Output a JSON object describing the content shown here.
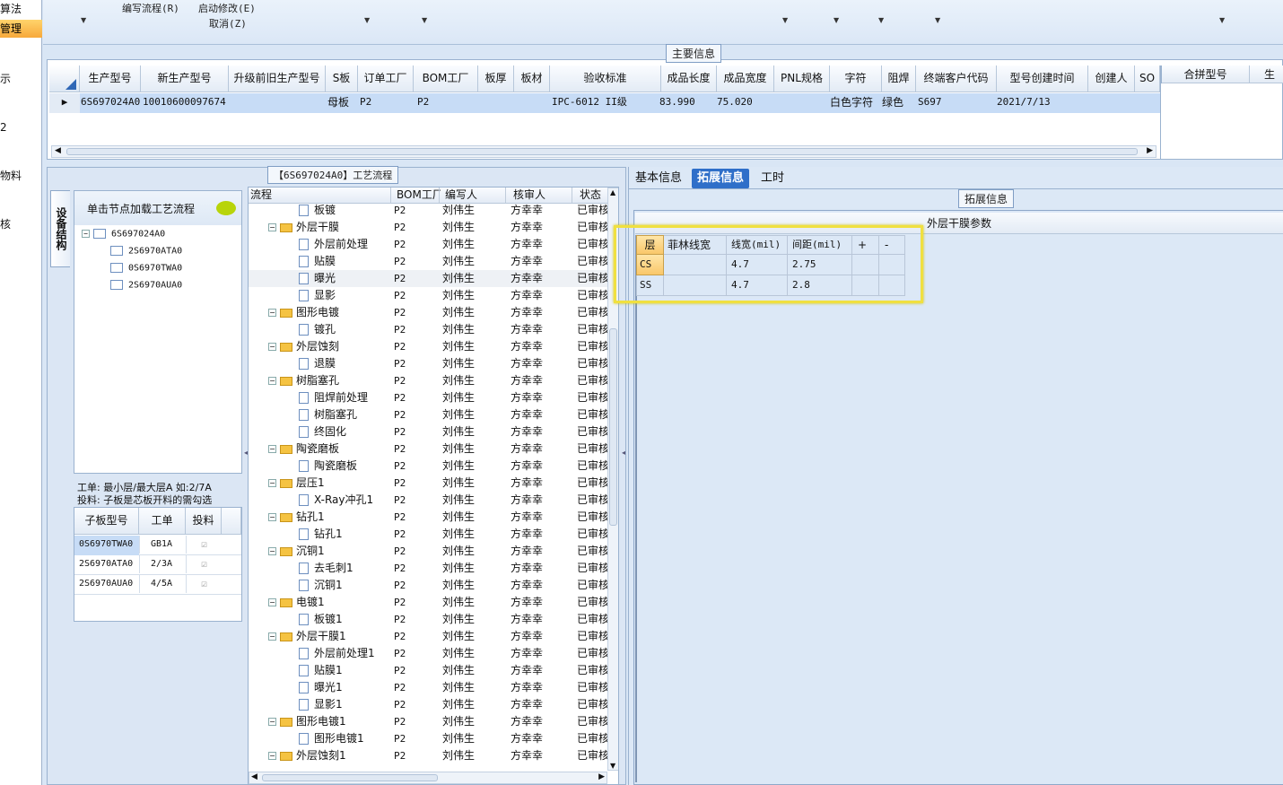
{
  "leftnav": {
    "items": [
      "算法",
      "管理",
      "示",
      "2",
      "物料",
      "核"
    ]
  },
  "toolbar": {
    "edit_flow": "编写流程(R)",
    "start_modify": "启动修改(E)",
    "cancel": "取消(Z)"
  },
  "main_info": {
    "caption": "主要信息",
    "columns": [
      "生产型号",
      "新生产型号",
      "升级前旧生产型号",
      "S板",
      "订单工厂",
      "BOM工厂",
      "板厚",
      "板材",
      "验收标准",
      "成品长度",
      "成品宽度",
      "PNL规格",
      "字符",
      "阻焊",
      "终端客户代码",
      "型号创建时间",
      "创建人",
      "SO"
    ],
    "row": [
      "6S697024A0",
      "10010600097674",
      "",
      "母板",
      "P2",
      "P2",
      "",
      "",
      "IPC-6012 II级",
      "83.990",
      "75.020",
      "",
      "白色字符",
      "绿色",
      "S697",
      "2021/7/13",
      "",
      ""
    ],
    "side_columns": [
      "合拼型号",
      "生"
    ]
  },
  "flow_panel": {
    "caption": "【6S697024A0】工艺流程"
  },
  "structure": {
    "vertical_tab": "设备结构",
    "hint": "单击节点加载工艺流程",
    "root": "6S697024A0",
    "children": [
      "2S6970ATA0",
      "0S6970TWA0",
      "2S6970AUA0"
    ],
    "note1": "工单: 最小层/最大层A 如:2/7A",
    "note2": "投料: 子板是芯板开料的需勾选",
    "sub_columns": [
      "子板型号",
      "工单",
      "投料"
    ],
    "sub_rows": [
      {
        "model": "0S6970TWA0",
        "order": "GB1A",
        "check": "☑"
      },
      {
        "model": "2S6970ATA0",
        "order": "2/3A",
        "check": "☑"
      },
      {
        "model": "2S6970AUA0",
        "order": "4/5A",
        "check": "☑"
      }
    ]
  },
  "process_tree": {
    "columns": [
      "流程",
      "BOM工厂",
      "编写人",
      "核审人",
      "状态"
    ],
    "rows": [
      {
        "name": "板镀",
        "type": "doc",
        "level": 2,
        "bom": "P2",
        "writer": "刘伟生",
        "checker": "方幸幸",
        "status": "已审核"
      },
      {
        "name": "外层干膜",
        "type": "folder",
        "level": 1,
        "bom": "P2",
        "writer": "刘伟生",
        "checker": "方幸幸",
        "status": "已审核"
      },
      {
        "name": "外层前处理",
        "type": "doc",
        "level": 2,
        "bom": "P2",
        "writer": "刘伟生",
        "checker": "方幸幸",
        "status": "已审核"
      },
      {
        "name": "贴膜",
        "type": "doc",
        "level": 2,
        "bom": "P2",
        "writer": "刘伟生",
        "checker": "方幸幸",
        "status": "已审核"
      },
      {
        "name": "曝光",
        "type": "doc",
        "level": 2,
        "bom": "P2",
        "writer": "刘伟生",
        "checker": "方幸幸",
        "status": "已审核"
      },
      {
        "name": "显影",
        "type": "doc",
        "level": 2,
        "bom": "P2",
        "writer": "刘伟生",
        "checker": "方幸幸",
        "status": "已审核"
      },
      {
        "name": "图形电镀",
        "type": "folder",
        "level": 1,
        "bom": "P2",
        "writer": "刘伟生",
        "checker": "方幸幸",
        "status": "已审核"
      },
      {
        "name": "镀孔",
        "type": "doc",
        "level": 2,
        "bom": "P2",
        "writer": "刘伟生",
        "checker": "方幸幸",
        "status": "已审核"
      },
      {
        "name": "外层蚀刻",
        "type": "folder",
        "level": 1,
        "bom": "P2",
        "writer": "刘伟生",
        "checker": "方幸幸",
        "status": "已审核"
      },
      {
        "name": "退膜",
        "type": "doc",
        "level": 2,
        "bom": "P2",
        "writer": "刘伟生",
        "checker": "方幸幸",
        "status": "已审核"
      },
      {
        "name": "树脂塞孔",
        "type": "folder",
        "level": 1,
        "bom": "P2",
        "writer": "刘伟生",
        "checker": "方幸幸",
        "status": "已审核"
      },
      {
        "name": "阻焊前处理",
        "type": "doc",
        "level": 2,
        "bom": "P2",
        "writer": "刘伟生",
        "checker": "方幸幸",
        "status": "已审核"
      },
      {
        "name": "树脂塞孔",
        "type": "doc",
        "level": 2,
        "bom": "P2",
        "writer": "刘伟生",
        "checker": "方幸幸",
        "status": "已审核"
      },
      {
        "name": "终固化",
        "type": "doc",
        "level": 2,
        "bom": "P2",
        "writer": "刘伟生",
        "checker": "方幸幸",
        "status": "已审核"
      },
      {
        "name": "陶瓷磨板",
        "type": "folder",
        "level": 1,
        "bom": "P2",
        "writer": "刘伟生",
        "checker": "方幸幸",
        "status": "已审核"
      },
      {
        "name": "陶瓷磨板",
        "type": "doc",
        "level": 2,
        "bom": "P2",
        "writer": "刘伟生",
        "checker": "方幸幸",
        "status": "已审核"
      },
      {
        "name": "层压1",
        "type": "folder",
        "level": 1,
        "bom": "P2",
        "writer": "刘伟生",
        "checker": "方幸幸",
        "status": "已审核"
      },
      {
        "name": "X-Ray冲孔1",
        "type": "doc",
        "level": 2,
        "bom": "P2",
        "writer": "刘伟生",
        "checker": "方幸幸",
        "status": "已审核"
      },
      {
        "name": "钻孔1",
        "type": "folder",
        "level": 1,
        "bom": "P2",
        "writer": "刘伟生",
        "checker": "方幸幸",
        "status": "已审核"
      },
      {
        "name": "钻孔1",
        "type": "doc",
        "level": 2,
        "bom": "P2",
        "writer": "刘伟生",
        "checker": "方幸幸",
        "status": "已审核"
      },
      {
        "name": "沉铜1",
        "type": "folder",
        "level": 1,
        "bom": "P2",
        "writer": "刘伟生",
        "checker": "方幸幸",
        "status": "已审核"
      },
      {
        "name": "去毛刺1",
        "type": "doc",
        "level": 2,
        "bom": "P2",
        "writer": "刘伟生",
        "checker": "方幸幸",
        "status": "已审核"
      },
      {
        "name": "沉铜1",
        "type": "doc",
        "level": 2,
        "bom": "P2",
        "writer": "刘伟生",
        "checker": "方幸幸",
        "status": "已审核"
      },
      {
        "name": "电镀1",
        "type": "folder",
        "level": 1,
        "bom": "P2",
        "writer": "刘伟生",
        "checker": "方幸幸",
        "status": "已审核"
      },
      {
        "name": "板镀1",
        "type": "doc",
        "level": 2,
        "bom": "P2",
        "writer": "刘伟生",
        "checker": "方幸幸",
        "status": "已审核"
      },
      {
        "name": "外层干膜1",
        "type": "folder",
        "level": 1,
        "bom": "P2",
        "writer": "刘伟生",
        "checker": "方幸幸",
        "status": "已审核"
      },
      {
        "name": "外层前处理1",
        "type": "doc",
        "level": 2,
        "bom": "P2",
        "writer": "刘伟生",
        "checker": "方幸幸",
        "status": "已审核"
      },
      {
        "name": "贴膜1",
        "type": "doc",
        "level": 2,
        "bom": "P2",
        "writer": "刘伟生",
        "checker": "方幸幸",
        "status": "已审核"
      },
      {
        "name": "曝光1",
        "type": "doc",
        "level": 2,
        "bom": "P2",
        "writer": "刘伟生",
        "checker": "方幸幸",
        "status": "已审核"
      },
      {
        "name": "显影1",
        "type": "doc",
        "level": 2,
        "bom": "P2",
        "writer": "刘伟生",
        "checker": "方幸幸",
        "status": "已审核"
      },
      {
        "name": "图形电镀1",
        "type": "folder",
        "level": 1,
        "bom": "P2",
        "writer": "刘伟生",
        "checker": "方幸幸",
        "status": "已审核"
      },
      {
        "name": "图形电镀1",
        "type": "doc",
        "level": 2,
        "bom": "P2",
        "writer": "刘伟生",
        "checker": "方幸幸",
        "status": "已审核"
      },
      {
        "name": "外层蚀刻1",
        "type": "folder",
        "level": 1,
        "bom": "P2",
        "writer": "刘伟生",
        "checker": "方幸幸",
        "status": "已审核"
      }
    ]
  },
  "right_tabs": {
    "items": [
      "基本信息",
      "拓展信息",
      "工时"
    ],
    "active": 1
  },
  "ext_info": {
    "caption": "拓展信息",
    "section_title": "外层干膜参数",
    "columns": [
      "层",
      "菲林线宽",
      "线宽(mil)",
      "间距(mil)",
      "+",
      "-"
    ],
    "rows": [
      [
        "CS",
        "",
        "4.7",
        "2.75",
        "",
        ""
      ],
      [
        "SS",
        "",
        "4.7",
        "2.8",
        "",
        ""
      ]
    ]
  },
  "colors": {
    "highlight": "#f0e040",
    "selected_row": "#c7dcf6",
    "accent": "#f7a93b"
  }
}
